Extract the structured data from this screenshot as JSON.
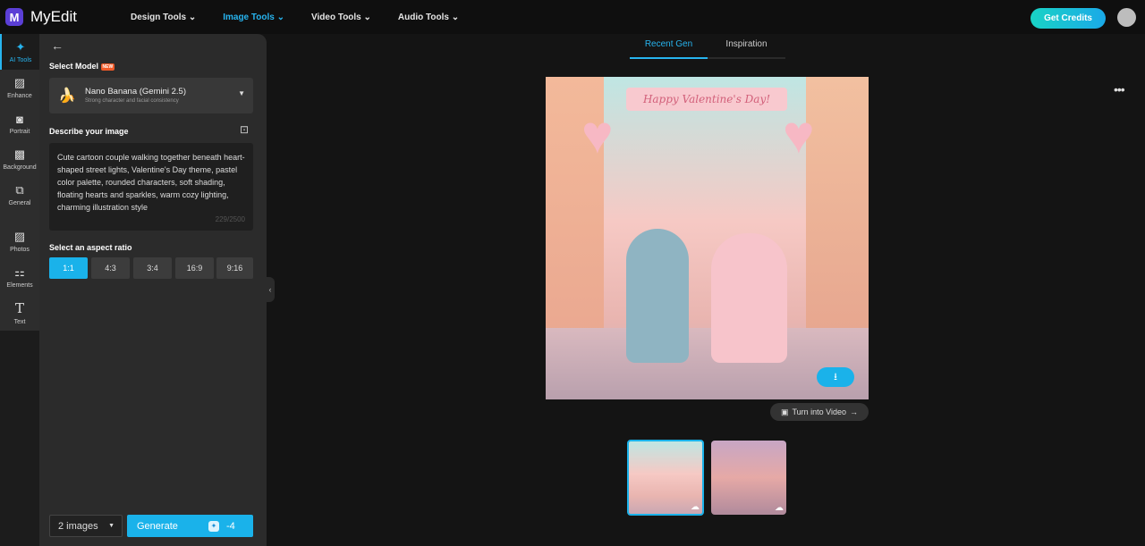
{
  "app": {
    "name": "MyEdit",
    "logo": "M"
  },
  "nav": [
    "Design Tools",
    "Image Tools",
    "Video Tools",
    "Audio Tools"
  ],
  "get_credits": "Get Credits",
  "rail": [
    {
      "label": "AI Tools",
      "icon": "magic-wand-icon"
    },
    {
      "label": "Enhance",
      "icon": "enhance-icon"
    },
    {
      "label": "Portrait",
      "icon": "portrait-icon"
    },
    {
      "label": "Background",
      "icon": "background-icon"
    },
    {
      "label": "General",
      "icon": "general-icon"
    },
    {
      "label": "Photos",
      "icon": "photos-icon"
    },
    {
      "label": "Elements",
      "icon": "elements-icon"
    },
    {
      "label": "Text",
      "icon": "text-icon"
    }
  ],
  "panel": {
    "select_model": "Select Model",
    "new_badge": "NEW",
    "model_name": "Nano Banana (Gemini 2.5)",
    "model_desc": "Strong character and facial consistency",
    "describe": "Describe your image",
    "prompt": "Cute cartoon couple walking together beneath heart-shaped street lights, Valentine's Day theme, pastel color palette, rounded characters, soft shading, floating hearts and sparkles, warm cozy lighting, charming illustration style",
    "char_count": "229/2500",
    "aspect_label": "Select an aspect ratio",
    "ratios": [
      "1:1",
      "4:3",
      "3:4",
      "16:9",
      "9:16"
    ],
    "selected_ratio": "1:1",
    "count": "2 images",
    "generate": "Generate",
    "cost": "-4"
  },
  "tabs": [
    "Recent Gen",
    "Inspiration"
  ],
  "image_banner": "Happy Valentine's Day!",
  "turn_into_video": "Turn into Video",
  "colors": {
    "accent": "#1ab2ea"
  }
}
